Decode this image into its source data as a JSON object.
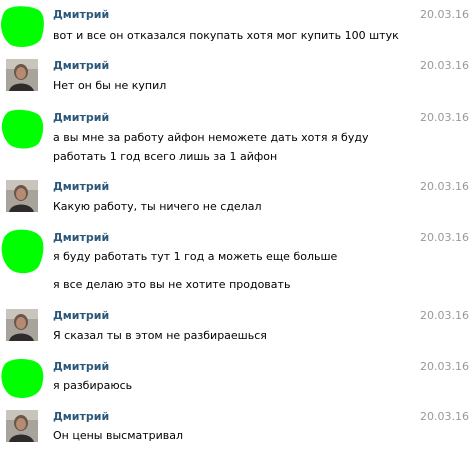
{
  "messages": [
    {
      "author": "Дмитрий",
      "date": "20.03.16",
      "avatar": "green-blob",
      "lines": [
        "вот и все он отказался покупать хотя мог купить 100 штук"
      ]
    },
    {
      "author": "Дмитрий",
      "date": "20.03.16",
      "avatar": "photo",
      "lines": [
        "Нет он бы не купил"
      ]
    },
    {
      "author": "Дмитрий",
      "date": "20.03.16",
      "avatar": "green-blob",
      "lines": [
        "а вы мне за работу айфон неможете дать хотя я буду",
        "работать 1 год всего лишь за 1 айфон"
      ]
    },
    {
      "author": "Дмитрий",
      "date": "20.03.16",
      "avatar": "photo",
      "lines": [
        "Какую работу, ты ничего не сделал"
      ]
    },
    {
      "author": "Дмитрий",
      "date": "20.03.16",
      "avatar": "green-blob",
      "lines": [
        "я буду работать тут 1 год а можеть еще больше"
      ],
      "extra": "я все делаю это вы не хотите продовать"
    },
    {
      "author": "Дмитрий",
      "date": "20.03.16",
      "avatar": "photo",
      "lines": [
        "Я сказал ты в этом не разбираешься"
      ]
    },
    {
      "author": "Дмитрий",
      "date": "20.03.16",
      "avatar": "green-blob",
      "lines": [
        "я разбираюсь"
      ]
    },
    {
      "author": "Дмитрий",
      "date": "20.03.16",
      "avatar": "photo",
      "lines": [
        "Он цены высматривал"
      ]
    }
  ],
  "colors": {
    "author": "#2b587a",
    "date": "#999999",
    "blob": "#00ff00",
    "text": "#000000"
  }
}
